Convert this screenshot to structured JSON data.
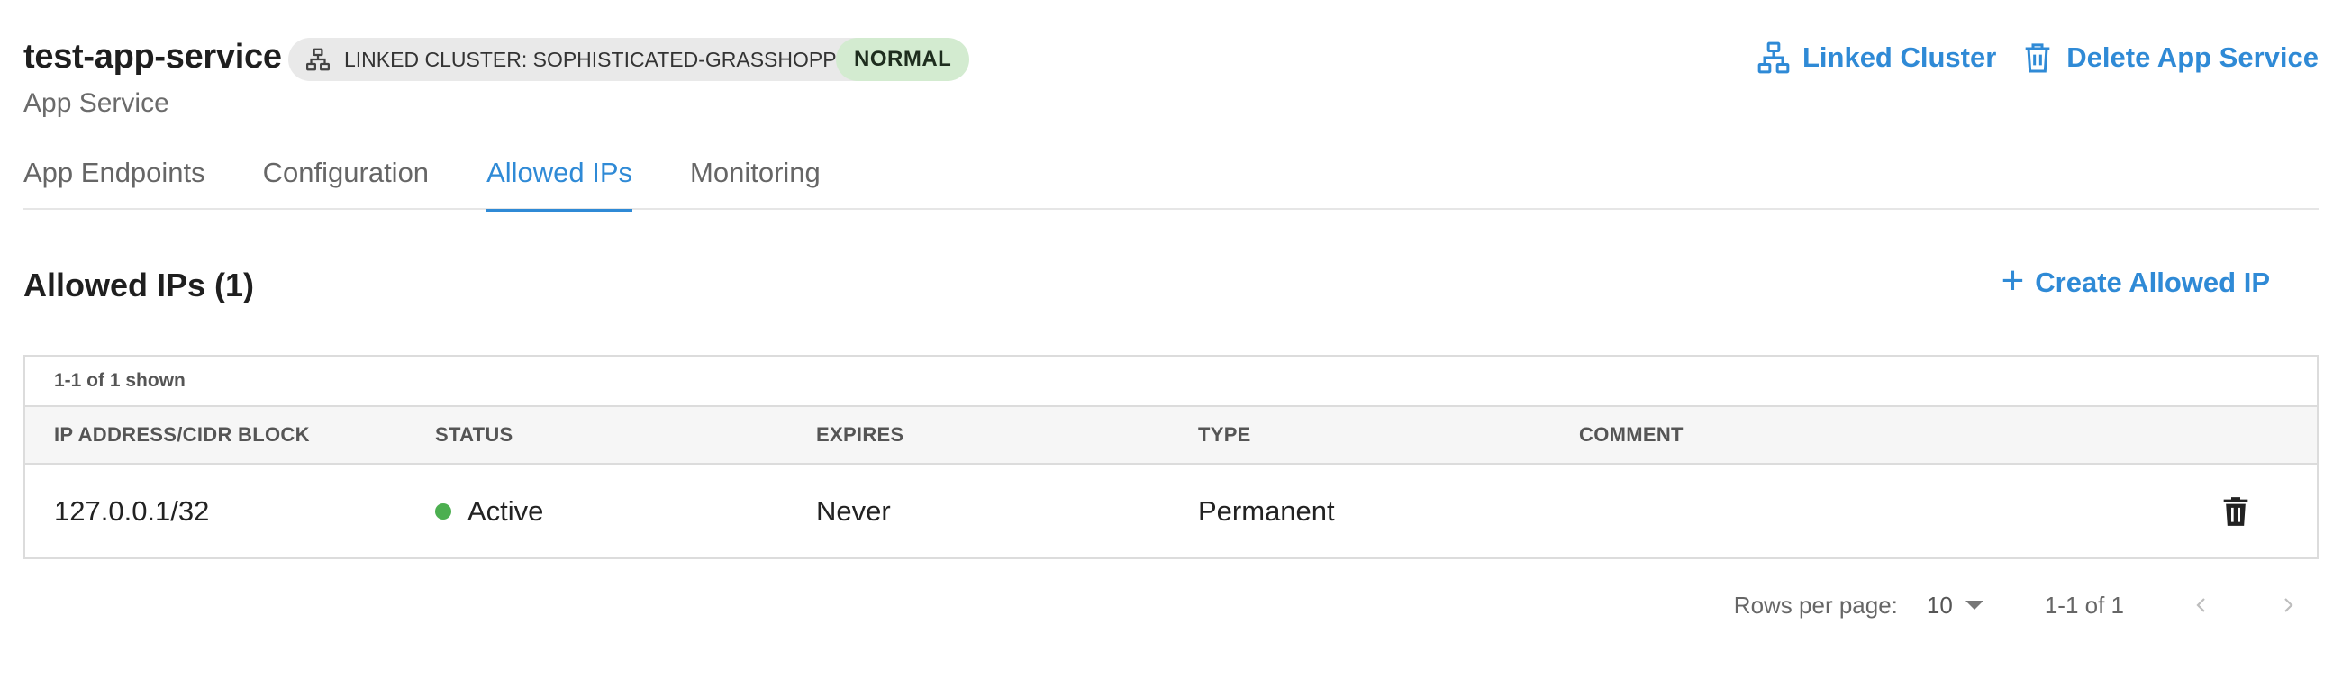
{
  "header": {
    "title": "test-app-service",
    "cluster_chip": "LINKED CLUSTER: SOPHISTICATED-GRASSHOPPER",
    "status_chip": "NORMAL",
    "subtitle": "App Service",
    "actions": {
      "linked_cluster": "Linked Cluster",
      "delete_service": "Delete App Service"
    }
  },
  "tabs": [
    {
      "label": "App Endpoints",
      "active": false
    },
    {
      "label": "Configuration",
      "active": false
    },
    {
      "label": "Allowed IPs",
      "active": true
    },
    {
      "label": "Monitoring",
      "active": false
    }
  ],
  "section": {
    "title": "Allowed IPs (1)",
    "create_label": "Create Allowed IP",
    "create_symbol": "+"
  },
  "table": {
    "count_text": "1-1 of 1 shown",
    "columns": [
      "IP ADDRESS/CIDR BLOCK",
      "STATUS",
      "EXPIRES",
      "TYPE",
      "COMMENT"
    ],
    "rows": [
      {
        "ip": "127.0.0.1/32",
        "status": "Active",
        "expires": "Never",
        "type": "Permanent",
        "comment": ""
      }
    ]
  },
  "pagination": {
    "rows_per_page_label": "Rows per page:",
    "rows_per_page_value": "10",
    "range_text": "1-1 of 1"
  },
  "colors": {
    "accent": "#2f8ad6",
    "status_active": "#4caf50",
    "normal_chip_bg": "#d3ebd0"
  },
  "icons": {
    "cluster": "network-icon",
    "delete": "trash-icon",
    "prev": "chevron-left-icon",
    "next": "chevron-right-icon"
  }
}
